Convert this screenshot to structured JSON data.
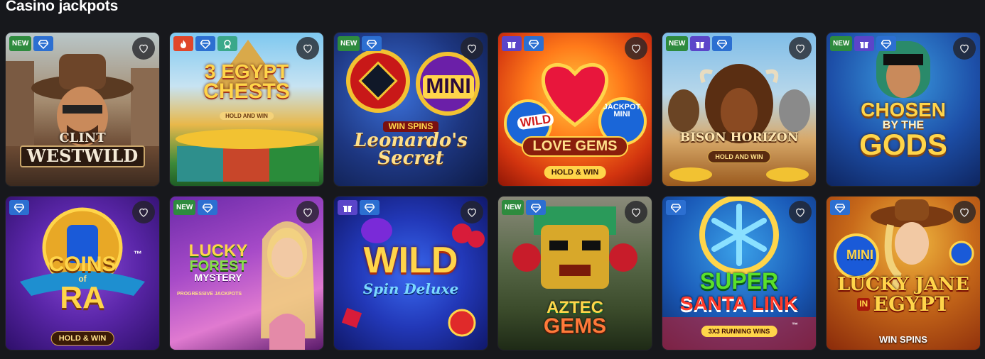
{
  "page": {
    "title": "Casino jackpots"
  },
  "badges": {
    "new": "NEW"
  },
  "colors": {
    "background": "#17181c",
    "badge_new": "#2e8b3e",
    "badge_jackpot": "#2c6fd1",
    "badge_gift": "#5b45c9",
    "badge_hot": "#e0462a",
    "badge_drops": "#3aa88a"
  },
  "games": [
    {
      "title_1": "CLINT",
      "title_2": "WESTWILD",
      "badges": [
        "new",
        "jackpot-icon"
      ]
    },
    {
      "title_1": "3 EGYPT",
      "title_2": "CHESTS",
      "subtitle": "HOLD AND WIN",
      "badges": [
        "hot-icon",
        "jackpot-icon",
        "drops-icon"
      ]
    },
    {
      "title_1": "WIN SPINS",
      "title_2": "Leonardo's",
      "title_3": "Secret",
      "tag": "MINI",
      "badges": [
        "new",
        "jackpot-icon"
      ]
    },
    {
      "title_1": "WILD",
      "title_2": "LOVE GEMS",
      "subtitle": "HOLD & WIN",
      "tag": "JACKPOT MINI",
      "badges": [
        "gift-icon",
        "jackpot-icon"
      ]
    },
    {
      "title_1": "BISON HORIZON",
      "subtitle": "HOLD AND WIN",
      "badges": [
        "new",
        "gift-icon",
        "jackpot-icon"
      ]
    },
    {
      "title_1": "CHOSEN",
      "title_2": "BY THE",
      "title_3": "GODS",
      "badges": [
        "new",
        "gift-icon",
        "jackpot-icon"
      ]
    },
    {
      "title_1": "COINS",
      "title_2": "of",
      "title_3": "RA",
      "subtitle": "HOLD & WIN",
      "tm": "™",
      "badges": [
        "jackpot-icon"
      ]
    },
    {
      "title_1": "LUCKY",
      "title_2": "FOREST",
      "title_3": "MYSTERY",
      "subtitle": "PROGRESSIVE JACKPOTS",
      "badges": [
        "new",
        "jackpot-icon"
      ]
    },
    {
      "title_1": "WILD",
      "title_2": "Spin Deluxe",
      "badges": [
        "gift-icon",
        "jackpot-icon"
      ]
    },
    {
      "title_1": "AZTEC",
      "title_2": "GEMS",
      "badges": [
        "new",
        "jackpot-icon"
      ]
    },
    {
      "title_1": "SUPER",
      "title_2": "SANTA LINK",
      "subtitle": "3X3 RUNNING WINS",
      "tm": "™",
      "badges": [
        "jackpot-icon"
      ]
    },
    {
      "title_1": "LUCKY JANE",
      "title_2": "IN",
      "title_3": "EGYPT",
      "subtitle": "WIN SPINS",
      "tag": "MINI",
      "badges": [
        "jackpot-icon"
      ]
    }
  ]
}
